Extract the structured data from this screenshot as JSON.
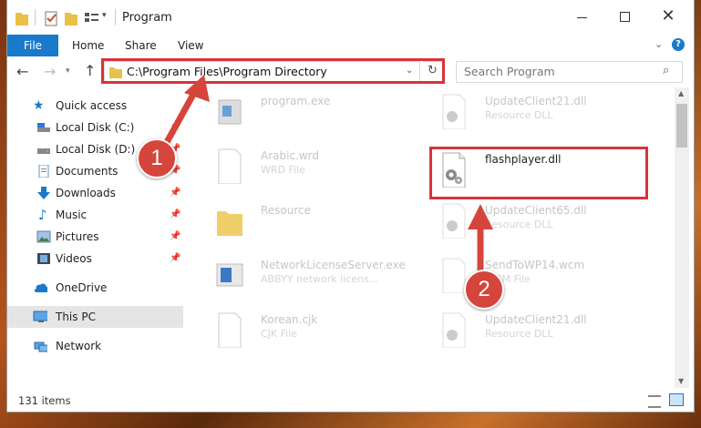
{
  "window": {
    "title": "Program"
  },
  "ribbon": {
    "tabs": [
      "File",
      "Home",
      "Share",
      "View"
    ]
  },
  "address": {
    "path": "C:\\Program Files\\Program Directory"
  },
  "search": {
    "placeholder": "Search Program"
  },
  "sidebar": {
    "items": [
      {
        "label": "Quick access",
        "icon": "star-icon",
        "pinned": false
      },
      {
        "label": "Local Disk (C:)",
        "icon": "drive-icon",
        "pinned": true
      },
      {
        "label": "Local Disk (D:)",
        "icon": "drive-icon",
        "pinned": true
      },
      {
        "label": "Documents",
        "icon": "documents-icon",
        "pinned": true
      },
      {
        "label": "Downloads",
        "icon": "download-arrow-icon",
        "pinned": true
      },
      {
        "label": "Music",
        "icon": "music-note-icon",
        "pinned": true
      },
      {
        "label": "Pictures",
        "icon": "pictures-icon",
        "pinned": true
      },
      {
        "label": "Videos",
        "icon": "film-icon",
        "pinned": true
      },
      {
        "label": "OneDrive",
        "icon": "cloud-icon",
        "pinned": false
      },
      {
        "label": "This PC",
        "icon": "computer-icon",
        "pinned": false,
        "selected": true
      },
      {
        "label": "Network",
        "icon": "network-icon",
        "pinned": false
      }
    ]
  },
  "files": {
    "left": [
      {
        "name": "program.exe",
        "type": ""
      },
      {
        "name": "Arabic.wrd",
        "type": "WRD File"
      },
      {
        "name": "Resource",
        "type": ""
      },
      {
        "name": "NetworkLicenseServer.exe",
        "type": "ABBYY network licens..."
      },
      {
        "name": "Korean.cjk",
        "type": "CJK File"
      }
    ],
    "right": [
      {
        "name": "UpdateClient21.dll",
        "type": "Resource DLL"
      },
      {
        "name": "flashplayer.dll",
        "type": ""
      },
      {
        "name": "UpdateClient65.dll",
        "type": "Resource DLL"
      },
      {
        "name": "SendToWP14.wcm",
        "type": "WCM File"
      },
      {
        "name": "UpdateClient21.dll",
        "type": "Resource DLL"
      }
    ]
  },
  "status": {
    "items_count": "131 items"
  },
  "annotations": {
    "step1": "1",
    "step2": "2"
  },
  "colors": {
    "accent": "#1979ca",
    "highlight": "#d9333a",
    "badge": "#d6453b"
  }
}
